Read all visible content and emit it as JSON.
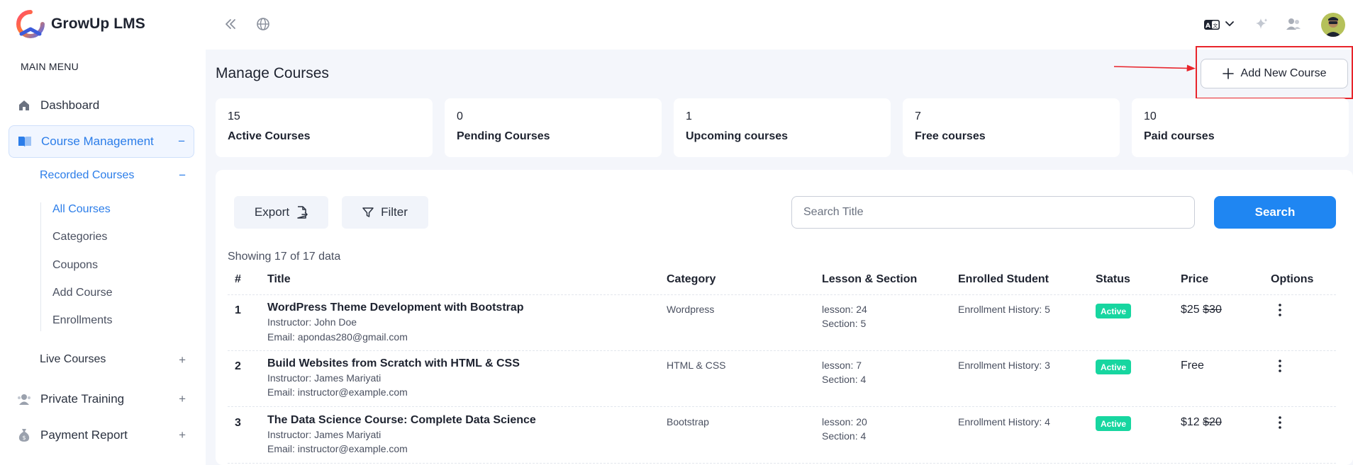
{
  "app": {
    "name": "GrowUp LMS"
  },
  "sidebar": {
    "heading": "MAIN MENU",
    "dashboard": "Dashboard",
    "course_management": {
      "label": "Course Management",
      "toggle": "−"
    },
    "recorded_courses": {
      "label": "Recorded Courses",
      "toggle": "−"
    },
    "sub_items": [
      "All Courses",
      "Categories",
      "Coupons",
      "Add Course",
      "Enrollments"
    ],
    "live_courses": {
      "label": "Live Courses",
      "toggle": "+"
    },
    "private_training": {
      "label": "Private Training",
      "toggle": "+"
    },
    "payment_report": {
      "label": "Payment Report",
      "toggle": "+"
    }
  },
  "topbar": {
    "icons": [
      "collapse-icon",
      "globe-icon",
      "language-icon",
      "chevron-down-icon",
      "sparkle-icon",
      "users-icon",
      "avatar"
    ]
  },
  "page": {
    "title": "Manage Courses",
    "add_button": "Add New Course"
  },
  "stats": [
    {
      "value": "15",
      "label": "Active Courses"
    },
    {
      "value": "0",
      "label": "Pending Courses"
    },
    {
      "value": "1",
      "label": "Upcoming courses"
    },
    {
      "value": "7",
      "label": "Free courses"
    },
    {
      "value": "10",
      "label": "Paid courses"
    }
  ],
  "toolbar": {
    "export": "Export",
    "filter": "Filter",
    "search_placeholder": "Search Title",
    "search_button": "Search"
  },
  "table": {
    "showing": "Showing 17 of 17 data",
    "headers": [
      "#",
      "Title",
      "Category",
      "Lesson & Section",
      "Enrolled Student",
      "Status",
      "Price",
      "Options"
    ],
    "rows": [
      {
        "num": "1",
        "title": "WordPress Theme Development with Bootstrap",
        "instructor": "Instructor: John Doe",
        "email": "Email: apondas280@gmail.com",
        "category": "Wordpress",
        "lesson": "lesson: 24",
        "section": "Section: 5",
        "enrolled": "Enrollment History: 5",
        "status": "Active",
        "price": "$25",
        "old_price": "$30"
      },
      {
        "num": "2",
        "title": "Build Websites from Scratch with HTML & CSS",
        "instructor": "Instructor: James Mariyati",
        "email": "Email: instructor@example.com",
        "category": "HTML & CSS",
        "lesson": "lesson: 7",
        "section": "Section: 4",
        "enrolled": "Enrollment History: 3",
        "status": "Active",
        "price": "Free",
        "old_price": ""
      },
      {
        "num": "3",
        "title": "The Data Science Course: Complete Data Science",
        "instructor": "Instructor: James Mariyati",
        "email": "Email: instructor@example.com",
        "category": "Bootstrap",
        "lesson": "lesson: 20",
        "section": "Section: 4",
        "enrolled": "Enrollment History: 4",
        "status": "Active",
        "price": "$12",
        "old_price": "$20"
      }
    ]
  },
  "colors": {
    "accent": "#1f86f2",
    "active_nav": "#2b7de9",
    "status_active": "#17d6a0",
    "highlight": "#e8242b"
  }
}
